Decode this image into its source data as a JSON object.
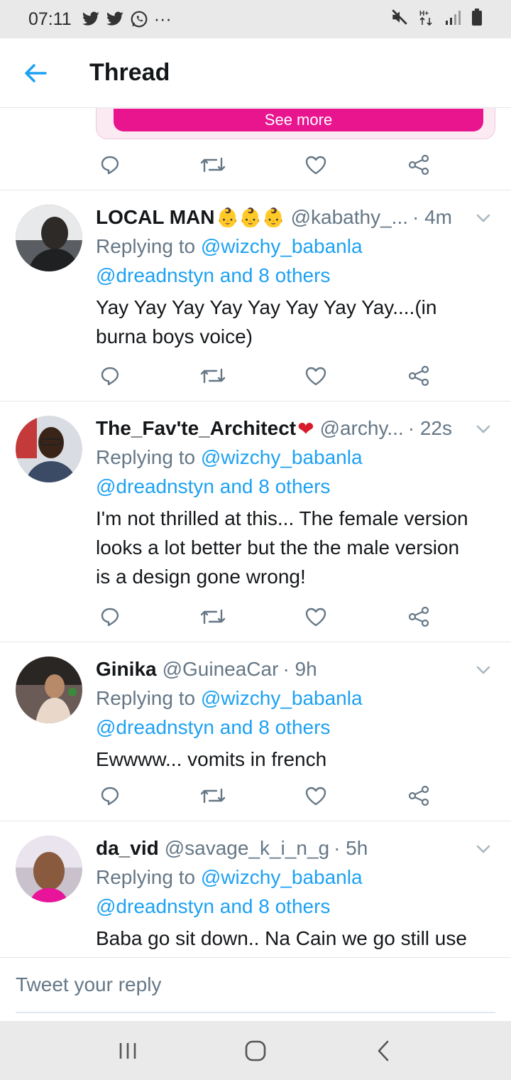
{
  "status_bar": {
    "time": "07:11",
    "more": "···"
  },
  "header": {
    "title": "Thread"
  },
  "top_card": {
    "see_more": "See more"
  },
  "tweets": [
    {
      "name": "LOCAL MAN",
      "emoji": "👶👶👶",
      "handle": "@kabathy_...",
      "time": "· 4m",
      "replying_prefix": "Replying to",
      "replying_mention": "@wizchy_babanla",
      "replying_others": "@dreadnstyn and 8 others",
      "text_lines": [
        "Yay Yay Yay Yay Yay Yay Yay Yay....(in",
        "burna boys voice)"
      ],
      "avatar_bg": "#5a5d61"
    },
    {
      "name": "The_Fav'te_Architect",
      "emoji": "❤",
      "handle": "@archy...",
      "time": "· 22s",
      "replying_prefix": "Replying to",
      "replying_mention": "@wizchy_babanla",
      "replying_others": "@dreadnstyn and 8 others",
      "text_lines": [
        "I'm not thrilled at this... The female version",
        "looks a lot better but the the male version",
        "is a design gone wrong!"
      ],
      "avatar_bg": "#3b4b66"
    },
    {
      "name": "Ginika",
      "emoji": "",
      "handle": "@GuineaCar",
      "time": "· 9h",
      "replying_prefix": "Replying to",
      "replying_mention": "@wizchy_babanla",
      "replying_others": "@dreadnstyn and 8 others",
      "text_lines": [
        "Ewwww... vomits in french"
      ],
      "avatar_bg": "#6b5b57"
    },
    {
      "name": "da_vid",
      "emoji": "",
      "handle": "@savage_k_i_n_g",
      "time": "· 5h",
      "replying_prefix": "Replying to",
      "replying_mention": "@wizchy_babanla",
      "replying_others": "@dreadnstyn and 8 others",
      "text_lines": [
        "Baba go sit down.. Na Cain we go still use"
      ],
      "avatar_bg": "#8a5a3e"
    }
  ],
  "reply_bar": {
    "placeholder": "Tweet your reply"
  },
  "colors": {
    "accent": "#1da1f2",
    "secondary_text": "#657786",
    "see_more_pink": "#e8158f",
    "heart_red": "#d81b2c"
  },
  "icons": [
    "back-arrow-icon",
    "reply-icon",
    "retweet-icon",
    "like-icon",
    "share-icon",
    "chevron-down-icon"
  ]
}
